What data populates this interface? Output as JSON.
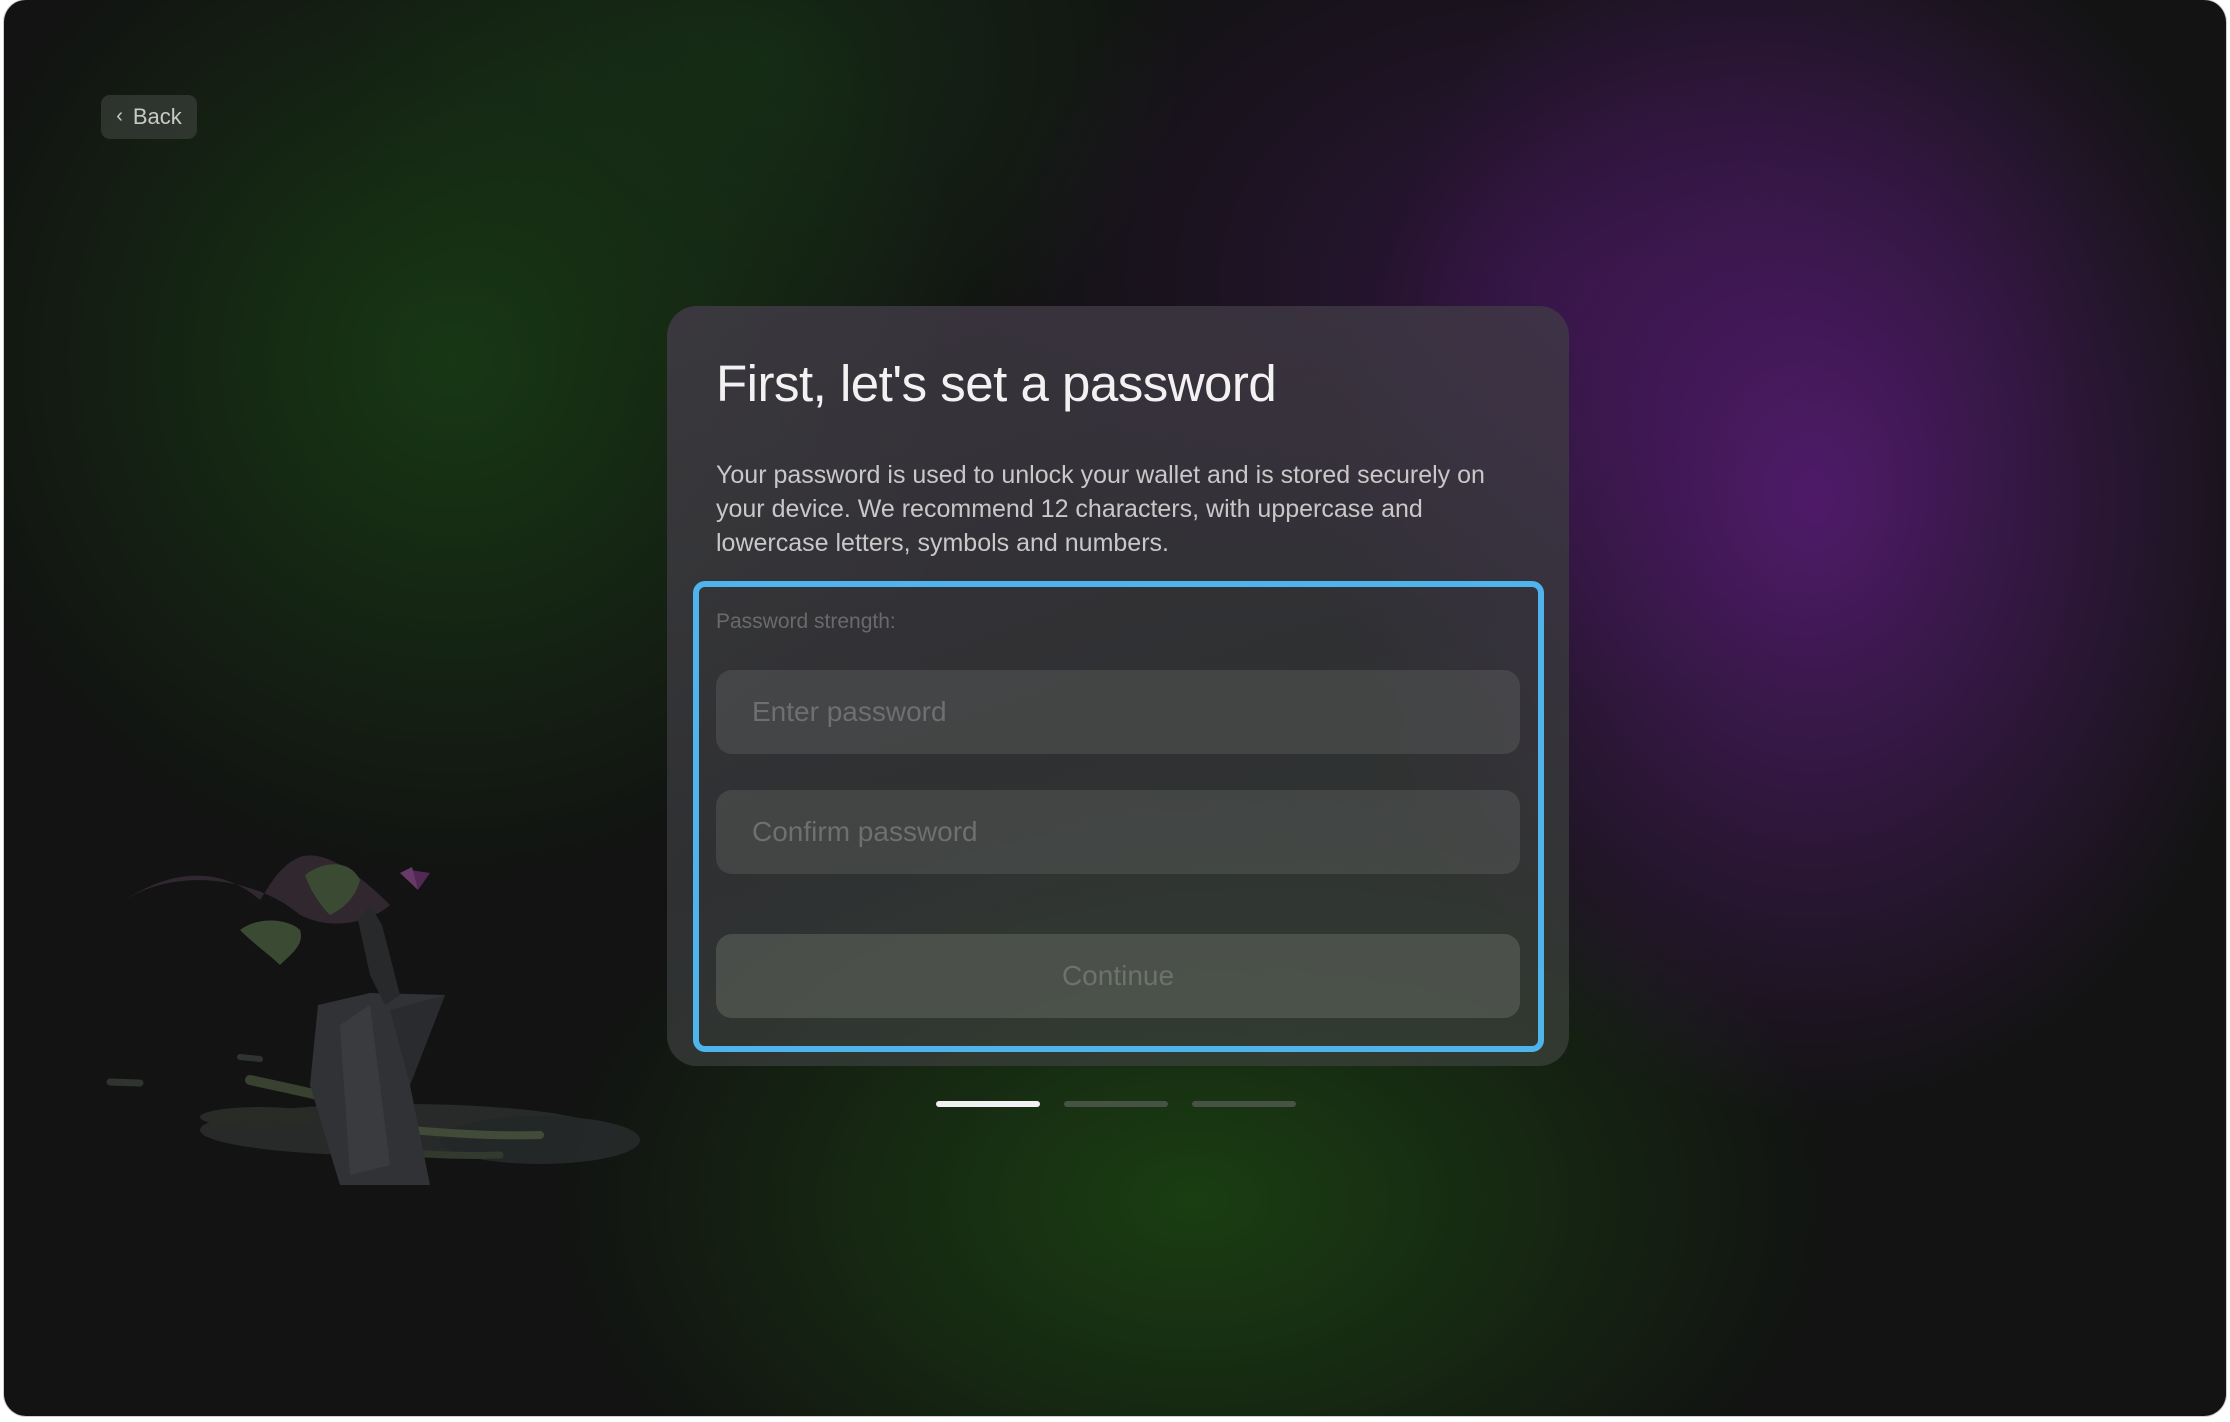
{
  "nav": {
    "back_label": "Back"
  },
  "card": {
    "title": "First, let's set a password",
    "description": "Your password is used to unlock your wallet and is stored securely on your device. We recommend 12 characters, with uppercase and lowercase letters, symbols and numbers.",
    "strength_label": "Password strength:",
    "password_placeholder": "Enter password",
    "confirm_placeholder": "Confirm password",
    "continue_label": "Continue"
  },
  "progress": {
    "total_steps": 3,
    "current_step": 1
  },
  "colors": {
    "focus_ring": "#4fb3ec",
    "background": "#121312"
  },
  "icons": {
    "back": "chevron-left-icon"
  }
}
